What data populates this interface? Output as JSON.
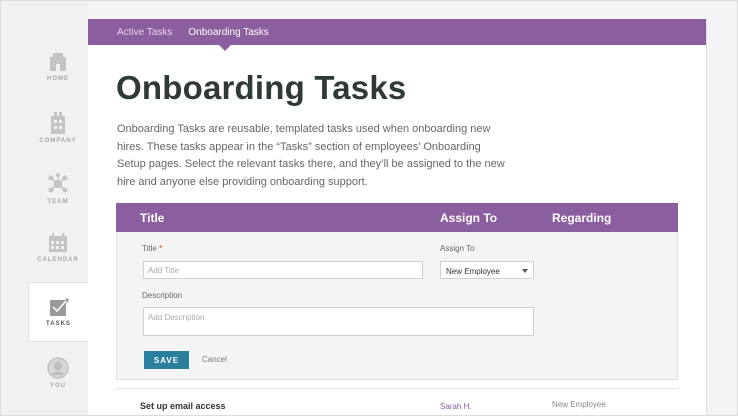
{
  "sidebar": {
    "items": [
      {
        "label": "HOME",
        "icon": "home-icon"
      },
      {
        "label": "COMPANY",
        "icon": "building-icon"
      },
      {
        "label": "TEAM",
        "icon": "team-network-icon"
      },
      {
        "label": "CALENDAR",
        "icon": "calendar-icon"
      },
      {
        "label": "TASKS",
        "icon": "checkmark-icon"
      },
      {
        "label": "YOU",
        "icon": "avatar-icon"
      }
    ]
  },
  "tabs": {
    "active_tasks": "Active Tasks",
    "onboarding_tasks": "Onboarding Tasks"
  },
  "page": {
    "title": "Onboarding Tasks",
    "description": "Onboarding Tasks are reusable, templated tasks used when onboarding new hires. These tasks appear in the “Tasks” section of employees’ Onboarding Setup pages. Select the relevant tasks there, and they’ll be assigned to the new hire and anyone else providing onboarding support."
  },
  "table": {
    "headers": {
      "title": "Title",
      "assign_to": "Assign To",
      "regarding": "Regarding"
    },
    "form": {
      "title_label": "Title",
      "required_mark": "*",
      "title_placeholder": "Add Title",
      "assign_label": "Assign To",
      "assign_value": "New Employee",
      "description_label": "Description",
      "description_placeholder": "Add Description",
      "save_label": "SAVE",
      "cancel_label": "Cancel"
    },
    "rows": [
      {
        "title": "Set up email access",
        "assign_to": "Sarah H.",
        "regarding": "New Employee"
      }
    ]
  },
  "colors": {
    "accent": "#8b5e9f",
    "button": "#2a7f9e"
  }
}
